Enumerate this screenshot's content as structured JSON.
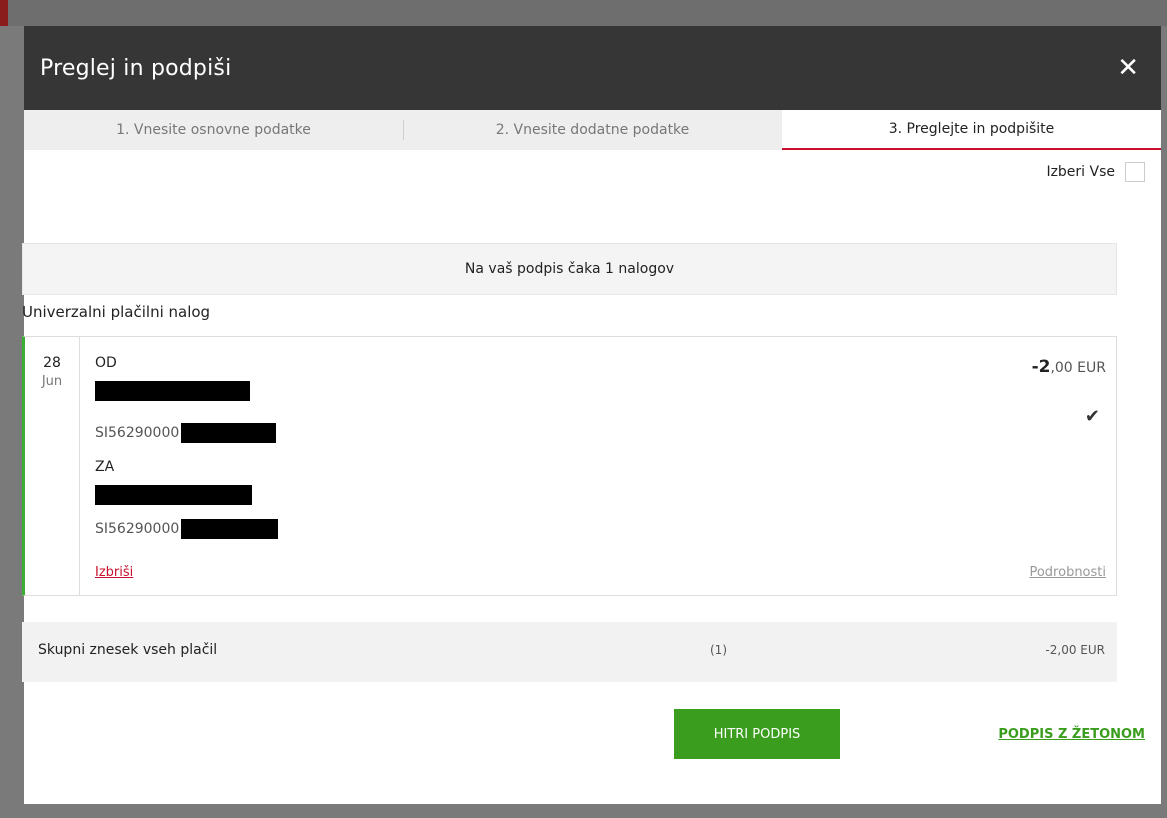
{
  "modal": {
    "title": "Preglej in podpiši",
    "close_icon": "close-icon",
    "close_symbol": "✕"
  },
  "steps": [
    {
      "label": "1. Vnesite osnovne podatke",
      "active": false
    },
    {
      "label": "2. Vnesite dodatne podatke",
      "active": false
    },
    {
      "label": "3. Preglejte in podpišite",
      "active": true
    }
  ],
  "select_all": {
    "label": "Izberi Vse",
    "checked": false
  },
  "waiting_message": "Na vaš podpis čaka 1 nalogov",
  "section_title": "Univerzalni plačilni nalog",
  "order": {
    "day": "28",
    "month": "Jun",
    "from_label": "OD",
    "from_iban_prefix": "SI56290000",
    "to_label": "ZA",
    "to_iban_prefix": "SI56290000",
    "amount_main": "-2",
    "amount_rest": ",00 EUR",
    "checked": true,
    "check_icon": "check-icon",
    "check_symbol": "✔",
    "delete_label": "Izbriši",
    "details_label": "Podrobnosti",
    "accent_color": "#3cae35"
  },
  "totals": {
    "label": "Skupni znesek vseh plačil",
    "count": "(1)",
    "amount": "-2,00 EUR"
  },
  "actions": {
    "quick_sign_label": "HITRI PODPIS",
    "token_sign_label": "PODPIS Z ŽETONOM",
    "primary_color": "#3a9d1e",
    "active_step_color": "#c8102e"
  }
}
